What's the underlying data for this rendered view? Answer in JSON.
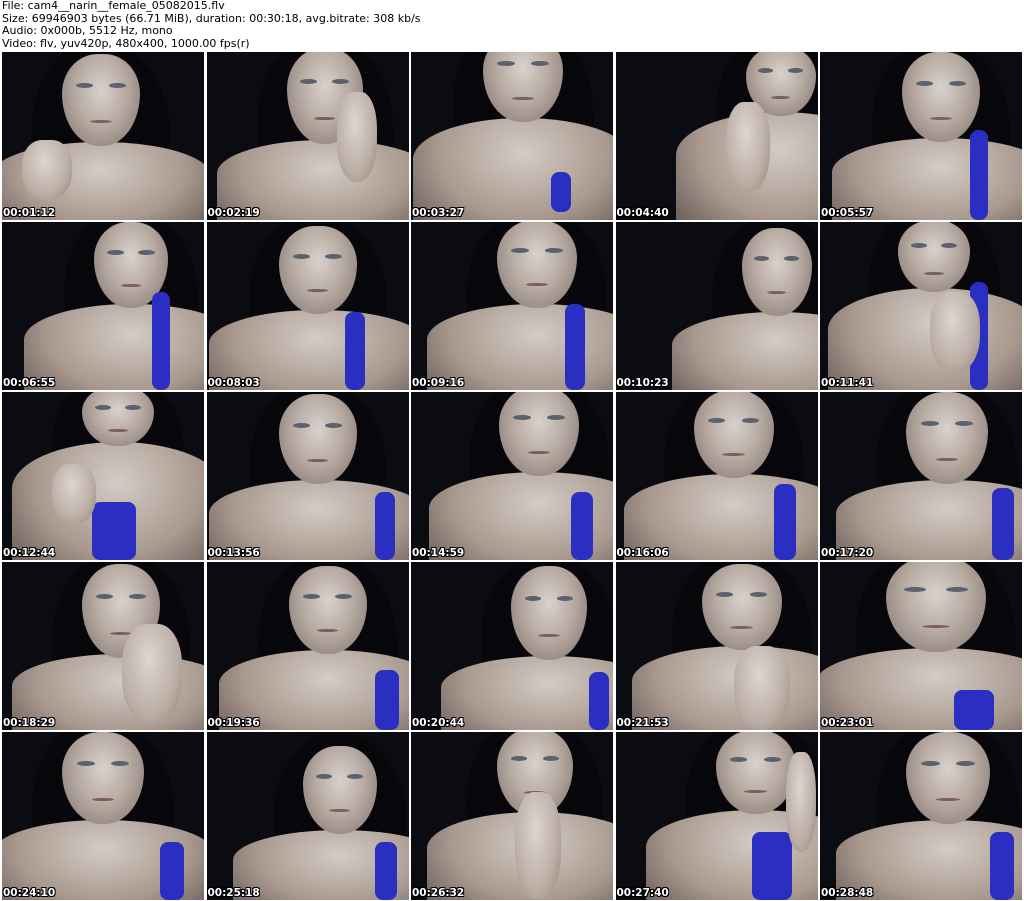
{
  "header": {
    "file_line": "File: cam4__narin__female_05082015.flv",
    "size_line": "Size: 69946903 bytes (66.71 MiB), duration: 00:30:18, avg.bitrate: 308 kb/s",
    "audio_line": "Audio: 0x000b, 5512 Hz, mono",
    "video_line": "Video: flv, yuv420p, 480x400, 1000.00 fps(r)"
  },
  "thumbnails": [
    {
      "time": "00:01:12",
      "icon": "video-frame"
    },
    {
      "time": "00:02:19",
      "icon": "video-frame"
    },
    {
      "time": "00:03:27",
      "icon": "video-frame"
    },
    {
      "time": "00:04:40",
      "icon": "video-frame"
    },
    {
      "time": "00:05:57",
      "icon": "video-frame"
    },
    {
      "time": "00:06:55",
      "icon": "video-frame"
    },
    {
      "time": "00:08:03",
      "icon": "video-frame"
    },
    {
      "time": "00:09:16",
      "icon": "video-frame"
    },
    {
      "time": "00:10:23",
      "icon": "video-frame"
    },
    {
      "time": "00:11:41",
      "icon": "video-frame"
    },
    {
      "time": "00:12:44",
      "icon": "video-frame"
    },
    {
      "time": "00:13:56",
      "icon": "video-frame"
    },
    {
      "time": "00:14:59",
      "icon": "video-frame"
    },
    {
      "time": "00:16:06",
      "icon": "video-frame"
    },
    {
      "time": "00:17:20",
      "icon": "video-frame"
    },
    {
      "time": "00:18:29",
      "icon": "video-frame"
    },
    {
      "time": "00:19:36",
      "icon": "video-frame"
    },
    {
      "time": "00:20:44",
      "icon": "video-frame"
    },
    {
      "time": "00:21:53",
      "icon": "video-frame"
    },
    {
      "time": "00:23:01",
      "icon": "video-frame"
    },
    {
      "time": "00:24:10",
      "icon": "video-frame"
    },
    {
      "time": "00:25:18",
      "icon": "video-frame"
    },
    {
      "time": "00:26:32",
      "icon": "video-frame"
    },
    {
      "time": "00:27:40",
      "icon": "video-frame"
    },
    {
      "time": "00:28:48",
      "icon": "video-frame"
    }
  ],
  "colors": {
    "background": "#ffffff",
    "header_text": "#000000",
    "timestamp_text": "#ffffff",
    "top_color": "#2a2fc2"
  }
}
